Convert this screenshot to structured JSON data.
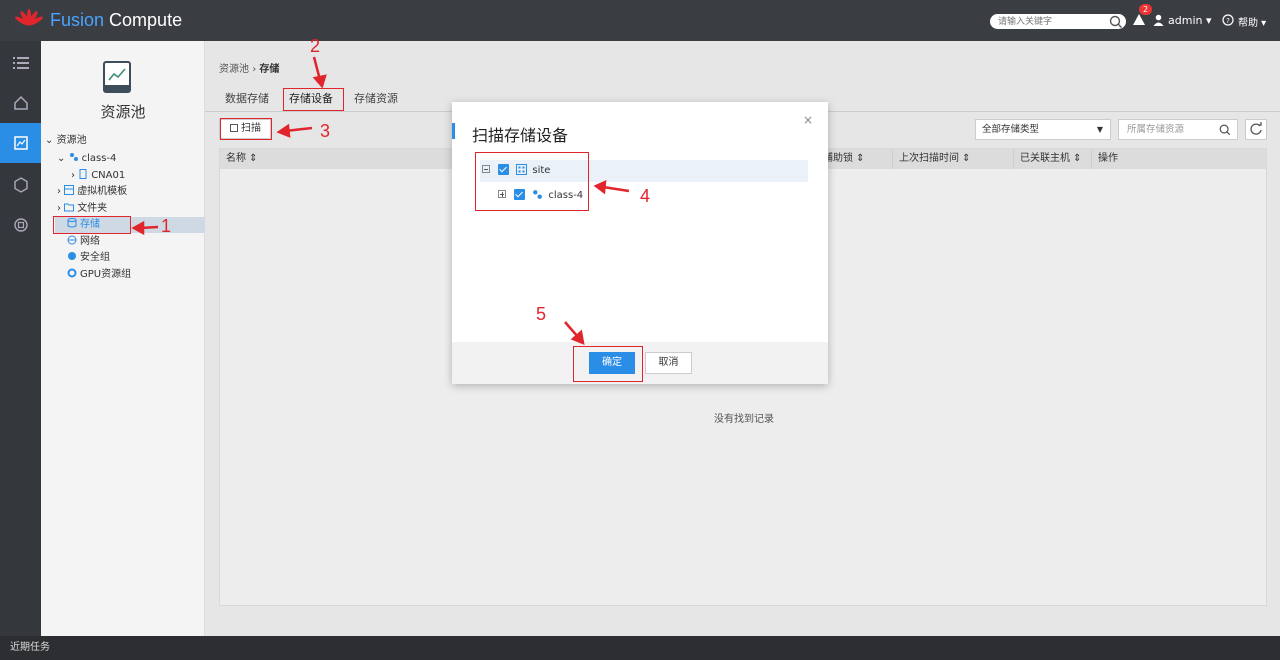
{
  "header": {
    "brand_part1": "Fusion",
    "brand_part2": "Compute",
    "search_placeholder": "请输入关键字",
    "alert_count": "2",
    "user": "admin ▾",
    "help": "帮助 ▾"
  },
  "rail": {
    "items": [
      "list-icon",
      "home-icon",
      "resource-pool-icon",
      "vm-icon",
      "compute-icon"
    ],
    "active_index": 2
  },
  "left_panel": {
    "title": "资源池",
    "tree": [
      {
        "label": "资源池",
        "icon": ""
      },
      {
        "label": "class-4",
        "icon": "cluster-icon"
      },
      {
        "label": "CNA01",
        "icon": "host-icon"
      },
      {
        "label": "虚拟机模板",
        "icon": "template-icon"
      },
      {
        "label": "文件夹",
        "icon": "folder-icon"
      },
      {
        "label": "存储",
        "icon": "storage-icon"
      },
      {
        "label": "网络",
        "icon": "network-icon"
      },
      {
        "label": "安全组",
        "icon": "security-group-icon"
      },
      {
        "label": "GPU资源组",
        "icon": "gpu-icon"
      }
    ]
  },
  "main": {
    "breadcrumb": {
      "parent": "资源池",
      "sep": "›",
      "current": "存储"
    },
    "tabs": [
      "数据存储",
      "存储设备",
      "存储资源"
    ],
    "active_tab": 1,
    "scan_button": "扫描",
    "filter_type": "全部存储类型",
    "filter_search_placeholder": "所属存储资源",
    "columns": [
      "名称",
      "辅助锁",
      "上次扫描时间",
      "已关联主机",
      "操作"
    ],
    "empty_text": "没有找到记录"
  },
  "statusbar": {
    "text": "近期任务"
  },
  "modal": {
    "title": "扫描存储设备",
    "close": "×",
    "tree": [
      {
        "label": "site",
        "checked": true,
        "expanded": true
      },
      {
        "label": "class-4",
        "checked": true,
        "expanded": false
      }
    ],
    "ok": "确定",
    "cancel": "取消"
  },
  "annotations": [
    "1",
    "2",
    "3",
    "4",
    "5"
  ],
  "colors": {
    "accent": "#2a8de6",
    "annotation": "#e0262c",
    "topbar": "#3a3d42"
  }
}
